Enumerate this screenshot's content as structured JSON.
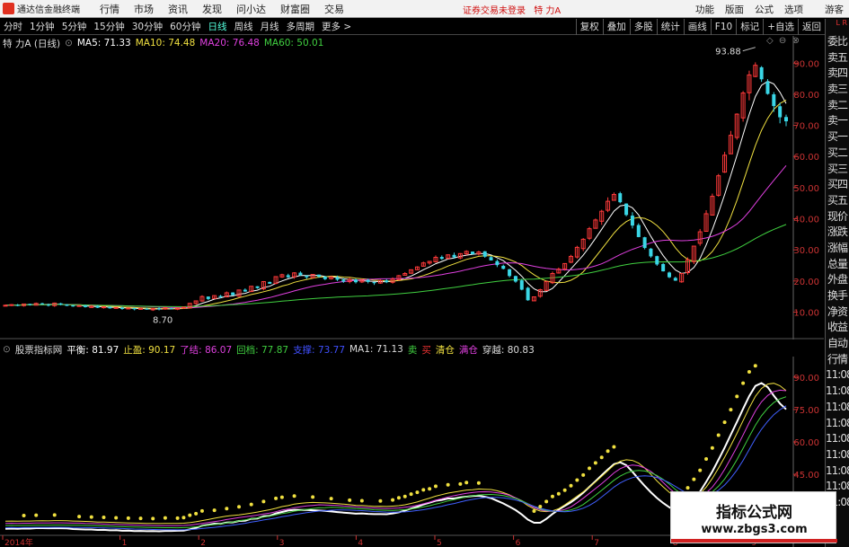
{
  "app": {
    "title": "通达信金融终端",
    "menu": [
      "行情",
      "市场",
      "资讯",
      "发现",
      "问小达",
      "财富圈",
      "交易"
    ],
    "login_notice": "证券交易未登录",
    "stock_title": "特 力A",
    "right_menu": [
      "功能",
      "版面",
      "公式",
      "选项"
    ],
    "guest": "游客"
  },
  "toolbar": {
    "periods": [
      "分时",
      "1分钟",
      "5分钟",
      "15分钟",
      "30分钟",
      "60分钟",
      "日线",
      "周线",
      "月线",
      "多周期",
      "更多 >"
    ],
    "active_period": "日线",
    "buttons": [
      "复权",
      "叠加",
      "多股",
      "统计",
      "画线",
      "F10",
      "标记",
      "+自选",
      "返回"
    ]
  },
  "side_panel": {
    "corner": "L R",
    "items": [
      "委比",
      "卖五",
      "卖四",
      "卖三",
      "卖二",
      "卖一",
      "买一",
      "买二",
      "买三",
      "买四",
      "买五",
      "现价",
      "涨跌",
      "涨幅",
      "总量",
      "外盘",
      "换手",
      "净资",
      "收益",
      "自动",
      "行情",
      "11:08",
      "11:08",
      "11:08",
      "11:08",
      "11:08",
      "11:08",
      "11:08",
      "11:08",
      "11:08"
    ]
  },
  "main_header": {
    "name": "特 力A (日线)",
    "ma5": "MA5: 71.33",
    "ma10": "MA10: 74.48",
    "ma20": "MA20: 76.48",
    "ma60": "MA60: 50.01",
    "colors": {
      "ma5": "#ffffff",
      "ma10": "#f0e040",
      "ma20": "#e040e0",
      "ma60": "#40d040"
    }
  },
  "sub_header": {
    "name": "股票指标网",
    "pingheng": "平衡: 81.97",
    "zhiying": "止盈: 90.17",
    "liaojie": "了结: 86.07",
    "huidang": "回档: 77.87",
    "zhicheng": "支撑: 73.77",
    "ma1": "MA1: 71.13",
    "mai": "卖",
    "buy": "买",
    "qingcang": "清仓",
    "mancang": "满仓",
    "chuanyue": "穿越: 80.83"
  },
  "chart_data": [
    {
      "type": "candlestick",
      "title": "特 力A (日线)",
      "y_ticks": [
        90.0,
        80.0,
        70.0,
        60.0,
        50.0,
        40.0,
        30.0,
        20.0,
        10.0
      ],
      "ylim": [
        3.5,
        97
      ],
      "annotations": [
        {
          "label": "93.88",
          "kind": "high"
        },
        {
          "label": "8.70",
          "kind": "low"
        }
      ],
      "close": [
        12.2,
        12.4,
        12.1,
        12.6,
        12.3,
        12.8,
        12.5,
        12.2,
        12.9,
        12.4,
        12.0,
        11.8,
        12.1,
        11.6,
        11.9,
        11.4,
        11.7,
        11.2,
        11.5,
        11.0,
        11.3,
        10.9,
        11.2,
        10.8,
        11.1,
        10.9,
        11.4,
        11.0,
        11.3,
        11.6,
        12.8,
        13.6,
        15.0,
        14.2,
        15.3,
        14.8,
        16.2,
        15.4,
        17.1,
        16.6,
        18.3,
        17.7,
        19.8,
        19.1,
        21.4,
        22.0,
        21.2,
        22.6,
        21.8,
        21.2,
        22.1,
        21.4,
        20.6,
        21.3,
        20.4,
        19.8,
        20.5,
        19.6,
        20.2,
        19.7,
        19.3,
        20.1,
        19.6,
        20.6,
        21.7,
        22.4,
        23.6,
        24.5,
        25.8,
        26.3,
        27.6,
        27.1,
        28.4,
        27.6,
        28.8,
        29.5,
        28.6,
        29.3,
        27.8,
        26.6,
        25.1,
        23.9,
        21.6,
        19.8,
        17.2,
        13.8,
        14.9,
        17.2,
        19.8,
        22.4,
        23.8,
        25.6,
        27.9,
        30.8,
        33.4,
        36.8,
        39.6,
        42.4,
        45.6,
        47.8,
        45.3,
        41.2,
        37.8,
        34.1,
        30.6,
        27.9,
        25.3,
        23.1,
        21.2,
        20.1,
        22.4,
        26.8,
        31.2,
        35.8,
        41.6,
        47.2,
        53.8,
        60.4,
        66.8,
        73.6,
        80.4,
        86.2,
        89.3,
        84.8,
        80.1,
        76.2,
        72.6,
        71.3
      ],
      "ma_lines": {
        "MA5": "#ffffff",
        "MA10": "#f0e040",
        "MA20": "#e040e0",
        "MA60": "#40d040"
      }
    },
    {
      "type": "line",
      "title": "股票指标网",
      "y_ticks": [
        90.0,
        75.0,
        60.0,
        45.0,
        30.0
      ],
      "ylim": [
        18,
        97
      ],
      "x_labels": [
        "2014年",
        "1",
        "2",
        "3",
        "4",
        "5",
        "6",
        "7",
        "8",
        "9"
      ],
      "series": [
        {
          "name": "平衡",
          "value": 81.97
        },
        {
          "name": "止盈",
          "value": 90.17
        },
        {
          "name": "了结",
          "value": 86.07
        },
        {
          "name": "回档",
          "value": 77.87
        },
        {
          "name": "支撑",
          "value": 73.77
        },
        {
          "name": "MA1",
          "value": 71.13
        },
        {
          "name": "穿越",
          "value": 80.83
        }
      ]
    }
  ],
  "watermark": {
    "title": "指标公式网",
    "url": "www.zbgs3.com"
  }
}
